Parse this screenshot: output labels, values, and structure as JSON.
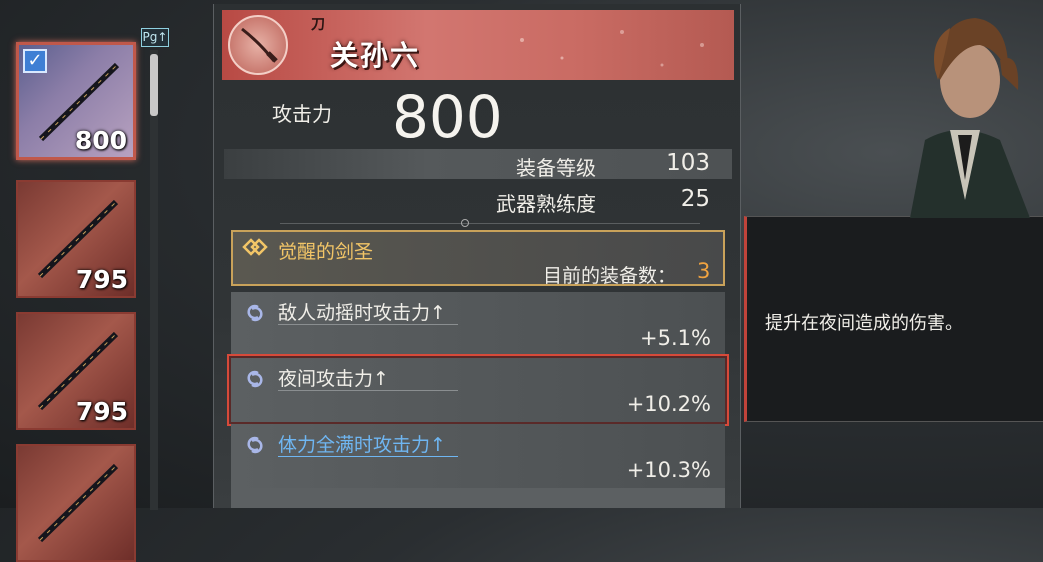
{
  "inventory": {
    "page_tag": "Pg↑",
    "slots": [
      {
        "value": "800",
        "selected": true
      },
      {
        "value": "795",
        "selected": false
      },
      {
        "value": "795",
        "selected": false
      },
      {
        "value": "",
        "selected": false
      }
    ]
  },
  "weapon": {
    "type": "刀",
    "name": "关孙六",
    "attack_label": "攻击力",
    "attack_value": "800",
    "stats": [
      {
        "label": "装备等级",
        "value": "103"
      },
      {
        "label": "武器熟练度",
        "value": "25"
      }
    ],
    "set": {
      "name": "觉醒的剑圣",
      "count_label": "目前的装备数：",
      "count": "3"
    },
    "bonuses": [
      {
        "name": "敌人动摇时攻击力↑",
        "value": "+5.1%"
      },
      {
        "name": "夜间攻击力↑",
        "value": "+10.2%"
      },
      {
        "name": "体力全满时攻击力↑",
        "value": "+10.3%"
      }
    ]
  },
  "tooltip": {
    "text": "提升在夜间造成的伤害。"
  },
  "colors": {
    "header": "#c96b63",
    "set_gold": "#f2c567",
    "count_orange": "#f0a340",
    "highlight_red": "#d74a3a",
    "blue_text": "#6fb6f2"
  }
}
